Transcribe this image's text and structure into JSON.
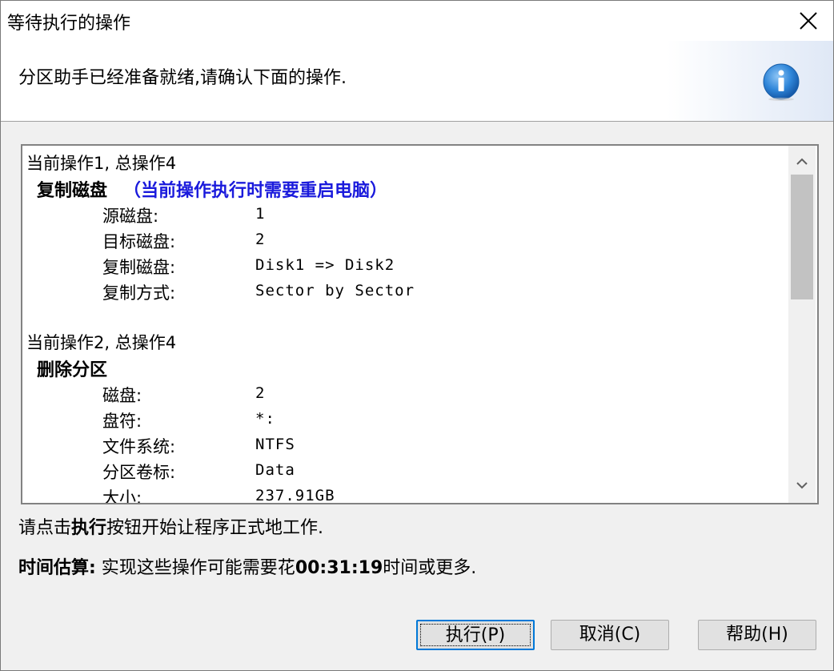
{
  "window": {
    "title": "等待执行的操作",
    "close_label": "×"
  },
  "header": {
    "message": "分区助手已经准备就绪,请确认下面的操作.",
    "icon": "info-icon"
  },
  "operations": [
    {
      "header": "当前操作1, 总操作4",
      "title": "复制磁盘",
      "note": "（当前操作执行时需要重启电脑）",
      "rows": [
        {
          "label": "源磁盘:",
          "value": "1"
        },
        {
          "label": "目标磁盘:",
          "value": "2"
        },
        {
          "label": "复制磁盘:",
          "value": "Disk1 => Disk2"
        },
        {
          "label": "复制方式:",
          "value": "Sector by Sector"
        }
      ]
    },
    {
      "header": "当前操作2, 总操作4",
      "title": "删除分区",
      "note": "",
      "rows": [
        {
          "label": "磁盘:",
          "value": "2"
        },
        {
          "label": "盘符:",
          "value": "*:"
        },
        {
          "label": "文件系统:",
          "value": "NTFS"
        },
        {
          "label": "分区卷标:",
          "value": "Data"
        },
        {
          "label": "大小:",
          "value": "237.91GB"
        }
      ]
    }
  ],
  "footer": {
    "prompt_prefix": "请点击",
    "prompt_bold": "执行",
    "prompt_suffix": "按钮开始让程序正式地工作.",
    "estimate_label": "时间估算:",
    "estimate_prefix": " 实现这些操作可能需要花",
    "estimate_time": "00:31:19",
    "estimate_suffix": "时间或更多."
  },
  "buttons": {
    "execute": "执行(P)",
    "cancel": "取消(C)",
    "help": "帮助(H)"
  },
  "colors": {
    "accent_blue": "#1a1adc",
    "info_icon": "#1f7bd6"
  }
}
